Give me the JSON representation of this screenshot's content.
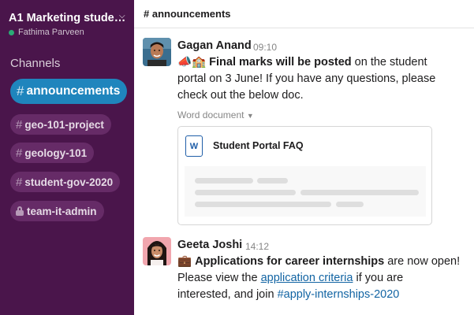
{
  "workspace": {
    "name": "A1 Marketing stude…",
    "user_name": "Fathima Parveen",
    "status_color": "#2bac76"
  },
  "sidebar": {
    "heading": "Channels",
    "channels": [
      {
        "name": "announcements",
        "active": true,
        "private": false
      },
      {
        "name": "geo-101-project",
        "active": false,
        "private": false
      },
      {
        "name": "geology-101",
        "active": false,
        "private": false
      },
      {
        "name": "student-gov-2020",
        "active": false,
        "private": false
      },
      {
        "name": "team-it-admin",
        "active": false,
        "private": true
      }
    ],
    "hash_symbol": "#"
  },
  "header": {
    "channel_title": "# announcements"
  },
  "messages": [
    {
      "author": "Gagan Anand",
      "time": "09:10",
      "emoji": "📣🏫",
      "bold_text": "Final marks will be posted",
      "text_line1": " on the student",
      "text_line2": "portal on 3 June! If you have any questions, please",
      "text_line3": "check out the below doc.",
      "attachment": {
        "type_label": "Word document",
        "icon_letter": "W",
        "title": "Student Portal FAQ"
      }
    },
    {
      "author": "Geeta Joshi",
      "time": "14:12",
      "emoji": "💼",
      "bold_text": "Applications for career internships",
      "text_line1": " are now open!",
      "text_line2_pre": "Please view the ",
      "link_text": "application criteria",
      "text_line2_post": " if you are",
      "text_line3_pre": "interested, and join ",
      "channel_link": "#apply-internships-2020"
    }
  ],
  "colors": {
    "sidebar_bg": "#4a154b",
    "active_channel": "#1f85bd",
    "link": "#1264a3"
  }
}
